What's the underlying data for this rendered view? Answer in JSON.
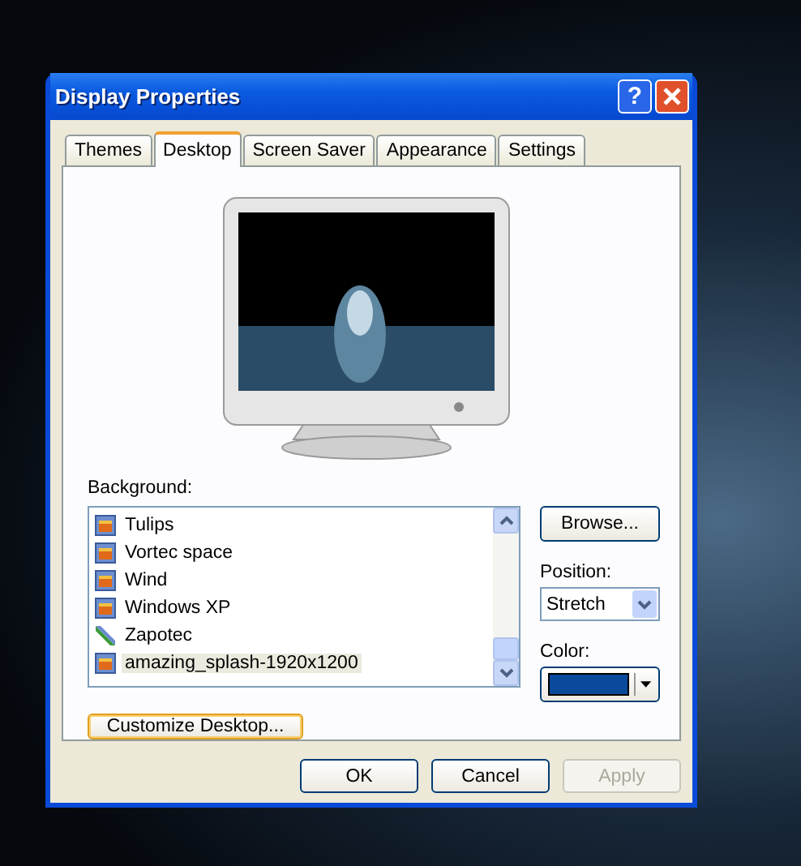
{
  "window": {
    "title": "Display Properties"
  },
  "title_buttons": [
    "?"
  ],
  "tabs": [
    {
      "label": "Themes",
      "selected": false
    },
    {
      "label": "Desktop",
      "selected": true
    },
    {
      "label": "Screen Saver",
      "selected": false
    },
    {
      "label": "Appearance",
      "selected": false
    },
    {
      "label": "Settings",
      "selected": false
    }
  ],
  "background": {
    "label": "Background:",
    "items": [
      {
        "name": "Tulips",
        "kind": "image",
        "selected": false
      },
      {
        "name": "Vortec space",
        "kind": "image",
        "selected": false
      },
      {
        "name": "Wind",
        "kind": "image",
        "selected": false
      },
      {
        "name": "Windows XP",
        "kind": "image",
        "selected": false
      },
      {
        "name": "Zapotec",
        "kind": "html",
        "selected": false
      },
      {
        "name": "amazing_splash-1920x1200",
        "kind": "image",
        "selected": true
      }
    ]
  },
  "browse_button": "Browse...",
  "position": {
    "label": "Position:",
    "value": "Stretch"
  },
  "color": {
    "label": "Color:",
    "color": "#0a4a9c"
  },
  "customize_button": "Customize Desktop...",
  "buttons": [
    {
      "label": "OK",
      "disabled": false
    },
    {
      "label": "Cancel",
      "disabled": false
    },
    {
      "label": "Apply",
      "disabled": true
    }
  ]
}
